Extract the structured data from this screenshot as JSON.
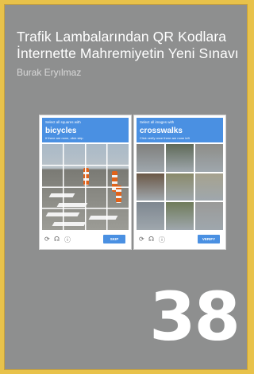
{
  "cover": {
    "title": "Trafik Lambalarından QR Kodlara İnternette Mahremiyetin Yeni Sınavı",
    "author": "Burak Eryılmaz",
    "issue_number": "38"
  },
  "captchas": [
    {
      "instruction": "Select all squares with",
      "target": "bicycles",
      "hint": "If there are none, click skip",
      "button_label": "SKIP",
      "tile_colors": []
    },
    {
      "instruction": "Select all images with",
      "target": "crosswalks",
      "hint": "Click verify once there are none left",
      "button_label": "VERIFY",
      "tile_colors": [
        "#7f7f7c",
        "#5f6a58",
        "#8d8d88",
        "#6b5847",
        "#8a8a6a",
        "#a6a28e",
        "#7e8790",
        "#6f7b5a",
        "#9a9a98"
      ]
    }
  ],
  "icons": {
    "reload": "reload-icon",
    "audio": "headphones-icon",
    "info": "info-icon"
  },
  "colors": {
    "background": "#e8c24a",
    "cover": "#8e8f8f",
    "captcha_accent": "#4a90e2"
  }
}
